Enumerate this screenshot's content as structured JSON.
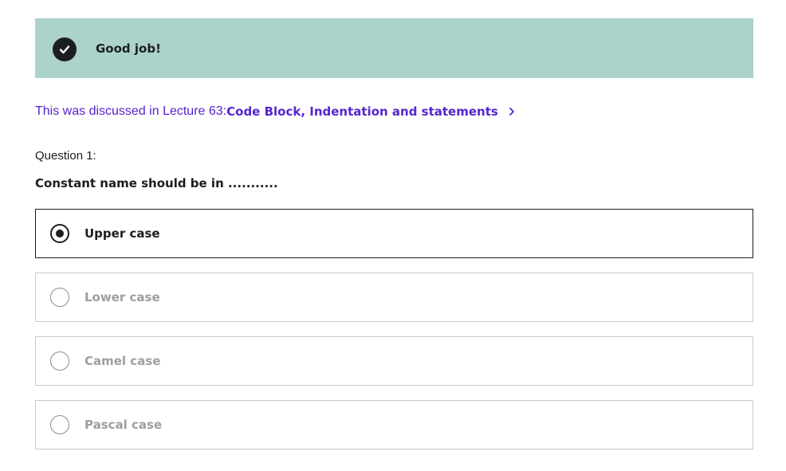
{
  "feedback": {
    "message": "Good job!",
    "icon": "check-circle-icon",
    "background_color": "#acd2cc"
  },
  "lecture_reference": {
    "prefix": "This was discussed in Lecture 63: ",
    "title": "Code Block, Indentation and statements",
    "icon": "chevron-right-icon",
    "color": "#5624d0"
  },
  "question": {
    "label": "Question 1:",
    "text": "Constant name should be in ..........."
  },
  "options": [
    {
      "label": "Upper case",
      "selected": true
    },
    {
      "label": "Lower case",
      "selected": false
    },
    {
      "label": "Camel case",
      "selected": false
    },
    {
      "label": "Pascal case",
      "selected": false
    }
  ]
}
